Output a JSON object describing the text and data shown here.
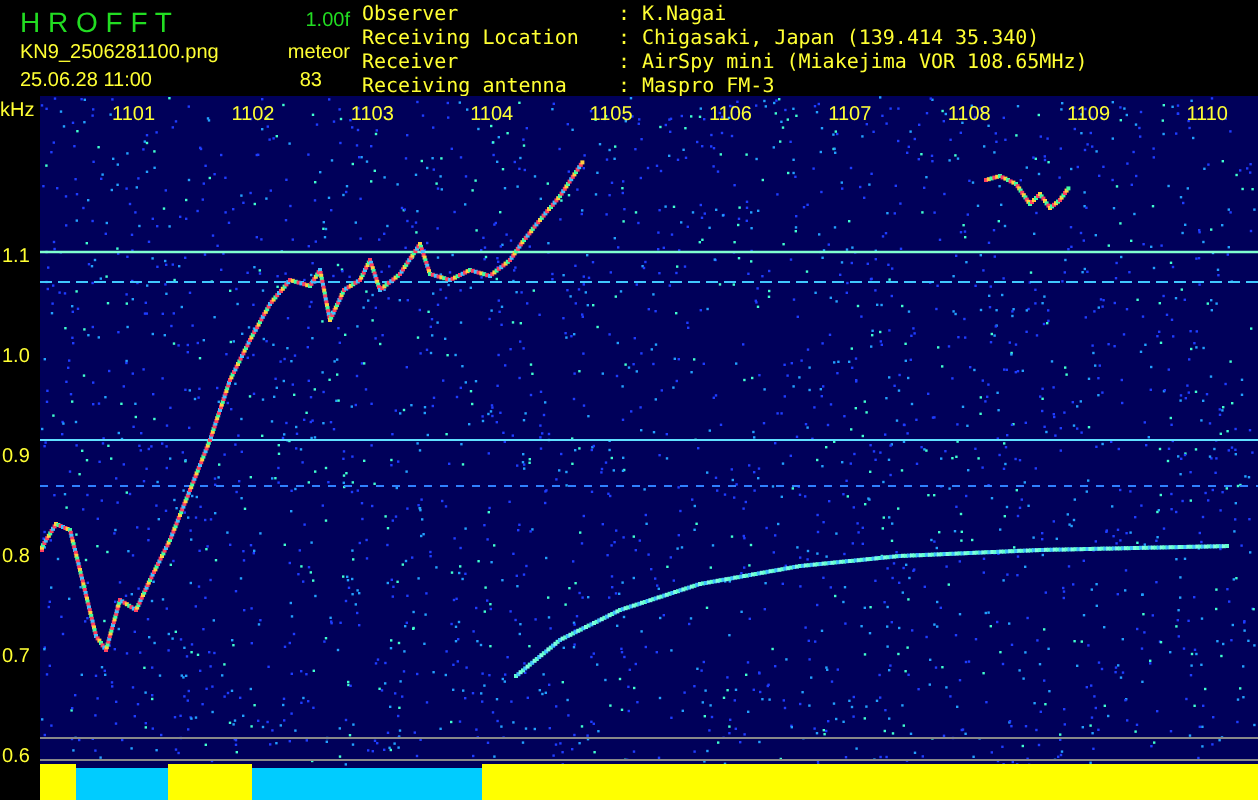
{
  "header": {
    "title": "H R O F F T",
    "version": "1.00f",
    "filename": "KN9_2506281100.png",
    "timestamp": "25.06.28 11:00",
    "count_label": "meteor",
    "count": "83"
  },
  "info": [
    {
      "label": "Observer",
      "separator": ":",
      "value": "K.Nagai"
    },
    {
      "label": "Receiving Location",
      "separator": ":",
      "value": "Chigasaki, Japan (139.414 35.340)"
    },
    {
      "label": "Receiver",
      "separator": ":",
      "value": "AirSpy mini (Miakejima VOR 108.65MHz)"
    },
    {
      "label": "Receiving antenna",
      "separator": ":",
      "value": "Maspro FM-3"
    }
  ],
  "spectrogram": {
    "unit": "kHz",
    "y_labels": [
      "1.1",
      "1.0",
      "0.9",
      "0.8",
      "0.7",
      "0.6"
    ],
    "time_labels": [
      "1101",
      "1102",
      "1103",
      "1104",
      "1105",
      "1106",
      "1107",
      "1108",
      "1109",
      "1110"
    ]
  }
}
